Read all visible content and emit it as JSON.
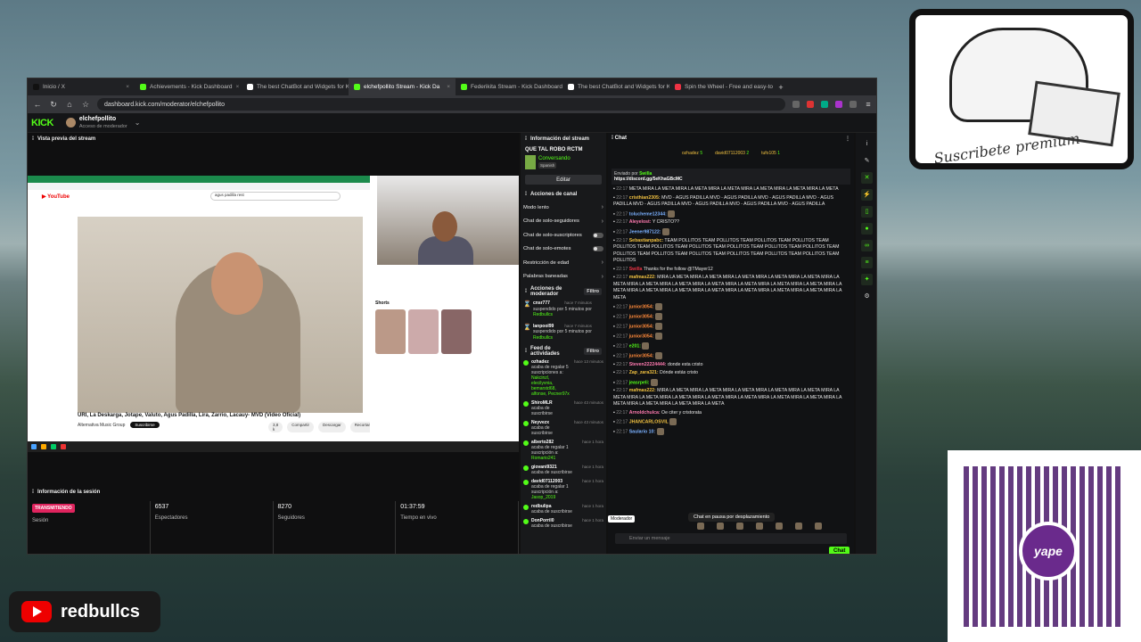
{
  "overlay": {
    "cat_caption": "Suscribete premium",
    "qr_brand": "yape",
    "channel_badge": "redbullcs"
  },
  "browser": {
    "tabs": [
      {
        "label": "Inicio / X",
        "color": "#111111",
        "active": false
      },
      {
        "label": "Achievements - Kick Dashboard",
        "color": "#53fc18",
        "active": false
      },
      {
        "label": "The best ChatBot and Widgets for K",
        "color": "#ffffff",
        "active": false
      },
      {
        "label": "elchefpollito Stream - Kick Da",
        "color": "#53fc18",
        "active": true
      },
      {
        "label": "Federikita Stream - Kick Dashboard",
        "color": "#53fc18",
        "active": false
      },
      {
        "label": "The best ChatBot and Widgets for K",
        "color": "#ffffff",
        "active": false
      },
      {
        "label": "Spin the Wheel - Free and easy-to",
        "color": "#e34",
        "active": false
      }
    ],
    "url": "dashboard.kick.com/moderator/elchefpollito"
  },
  "kick": {
    "logo": "KICK",
    "channel": "elchefpollito",
    "role": "Acceso de moderador"
  },
  "preview": {
    "title": "Vista previa del stream",
    "yt_search": "agus padilla rest",
    "video_title": "URI, La Deskarga, Jotape, Valuto, Agus Padilla, Lira, Zarrio, Lacauy- MVD (Video Oficial)",
    "video_channel": "Alternativa Music Group",
    "subscribe": "Suscribirse",
    "actions": [
      "3,8 k",
      "Compartir",
      "Descargar",
      "Recortar"
    ],
    "shorts_label": "Shorts"
  },
  "session": {
    "title": "Información de la sesión",
    "live_badge": "TRANSMITIENDO",
    "stats": [
      {
        "value": "",
        "label": "Sesión"
      },
      {
        "value": "6537",
        "label": "Espectadores"
      },
      {
        "value": "8270",
        "label": "Seguidores"
      },
      {
        "value": "01:37:59",
        "label": "Tiempo en vivo"
      }
    ]
  },
  "stream_info": {
    "title": "Información del stream",
    "stream_title": "QUE TAL ROBO RCTM",
    "category": "Conversando",
    "language": "Spanish",
    "edit": "Editar"
  },
  "channel_actions": {
    "title": "Acciones de canal",
    "items": [
      {
        "label": "Modo lento",
        "type": "chevron"
      },
      {
        "label": "Chat de solo-seguidores",
        "type": "chevron"
      },
      {
        "label": "Chat de solo-suscriptores",
        "type": "toggle"
      },
      {
        "label": "Chat de solo-emotes",
        "type": "toggle"
      },
      {
        "label": "Restricción de edad",
        "type": "chevron"
      },
      {
        "label": "Palabras baneadas",
        "type": "chevron"
      }
    ]
  },
  "mod_actions": {
    "title": "Acciones de moderador",
    "filter": "Filtro",
    "items": [
      {
        "user": "cnsr777",
        "text": "suspendido por 5 minutos por",
        "by": "Redbullcs",
        "time": "hace 7 minutos"
      },
      {
        "user": "lanpool99",
        "text": "suspendido por 5 minutos por",
        "by": "Redbullcs",
        "time": "hace 7 minutos"
      }
    ]
  },
  "activity": {
    "title": "Feed de actividades",
    "filter": "Filtro",
    "items": [
      {
        "user": "ozhadez",
        "text": "acaba de regalar 5 suscripciones a:",
        "extra": "Nakcinzl, elecilyvnia, bemarstd68, alfonse, Pecner97x",
        "time": "hace 13 minutos"
      },
      {
        "user": "ShiroMLR",
        "text": "acaba de suscribirse",
        "extra": "",
        "time": "hace 43 minutos"
      },
      {
        "user": "Neyvezx",
        "text": "acaba de suscribirse",
        "extra": "",
        "time": "hace 43 minutos"
      },
      {
        "user": "alberto282",
        "text": "acaba de regalar 1 suscripción a:",
        "extra": "Romario241",
        "time": "hace 1 hora"
      },
      {
        "user": "giovani9321",
        "text": "acaba de suscribirse",
        "extra": "",
        "time": "hace 1 hora"
      },
      {
        "user": "david07112003",
        "text": "acaba de regalar 1 suscripción a:",
        "extra": "Jasop_2019",
        "time": "hace 1 hora"
      },
      {
        "user": "redbulipa",
        "text": "acaba de suscribirse",
        "extra": "",
        "time": "hace 1 hora"
      },
      {
        "user": "DonPorril0",
        "text": "acaba de suscribirse",
        "extra": "",
        "time": "hace 1 hora"
      }
    ]
  },
  "chat": {
    "title": "Chat",
    "leaders": [
      {
        "name": "ozhadez",
        "count": "5"
      },
      {
        "name": "david07112003",
        "count": "2"
      },
      {
        "name": "tufo105",
        "count": "1"
      }
    ],
    "pinned_by": "Enviado por",
    "pinned_user": "Swilla",
    "pinned_link": "https://discord.gg/5eKhaGBcMC",
    "messages": [
      {
        "time": "22:17",
        "user": "",
        "color": "#dddddd",
        "text": "META MIRA LA META MIRA LA META MIRA LA META MIRA LA META MIRA LA META MIRA LA META"
      },
      {
        "time": "22:17",
        "user": "cristhian2305:",
        "color": "#f0c040",
        "text": "MVD - AGUS PADILLA MVD - AGUS PADILLA MVD - AGUS PADILLA MVD - AGUS PADILLA MVD - AGUS PADILLA MVD - AGUS PADILLA MVD - AGUS PADILLA MVD - AGUS PADILLA"
      },
      {
        "time": "22:17",
        "user": "tolucheme12344:",
        "color": "#7ab0ff",
        "text": ""
      },
      {
        "time": "22:17",
        "user": "Aleyelost:",
        "color": "#ff7ab0",
        "text": "Y CRISTO??"
      },
      {
        "time": "22:17",
        "user": "Jeener987122:",
        "color": "#7ab0ff",
        "text": ""
      },
      {
        "time": "22:17",
        "user": "Sebastianpabc:",
        "color": "#f0c040",
        "text": "TEAM POLLITOS TEAM POLLITOS TEAM POLLITOS TEAM POLLITOS TEAM POLLITOS TEAM POLLITOS TEAM POLLITOS TEAM POLLITOS TEAM POLLITOS TEAM POLLITOS TEAM POLLITOS TEAM POLLITOS TEAM POLLITOS TEAM POLLITOS TEAM POLLITOS TEAM POLLITOS TEAM POLLITOS"
      },
      {
        "time": "22:17",
        "user": "Swilla",
        "color": "#e34",
        "text": "Thanks for the follow @TMayer12"
      },
      {
        "time": "22:17",
        "user": "mafmas222:",
        "color": "#f0c040",
        "text": "MIRA LA META MIRA LA META MIRA LA META MIRA LA META MIRA LA META MIRA LA META MIRA LA META MIRA LA META MIRA LA META MIRA LA META MIRA LA META MIRA LA META MIRA LA META MIRA LA META MIRA LA META MIRA LA META MIRA LA META MIRA LA META MIRA LA META MIRA LA META"
      },
      {
        "time": "22:17",
        "user": "junior3054:",
        "color": "#ff8a3a",
        "text": ""
      },
      {
        "time": "22:17",
        "user": "junior3054:",
        "color": "#ff8a3a",
        "text": ""
      },
      {
        "time": "22:17",
        "user": "junior3054:",
        "color": "#ff8a3a",
        "text": ""
      },
      {
        "time": "22:17",
        "user": "junior3054:",
        "color": "#ff8a3a",
        "text": ""
      },
      {
        "time": "22:17",
        "user": "e201:",
        "color": "#53fc18",
        "text": ""
      },
      {
        "time": "22:17",
        "user": "junior3054:",
        "color": "#ff8a3a",
        "text": ""
      },
      {
        "time": "22:17",
        "user": "Steven22224444:",
        "color": "#ff7ab0",
        "text": "donde esta cristo"
      },
      {
        "time": "22:17",
        "user": "Zap_zara321:",
        "color": "#f0c040",
        "text": "Dónde estás cristo"
      },
      {
        "time": "22:17",
        "user": "jeasrpeli:",
        "color": "#53fc18",
        "text": ""
      },
      {
        "time": "22:17",
        "user": "mafmas222:",
        "color": "#f0c040",
        "text": "MIRA LA META MIRA LA META MIRA LA META MIRA LA META MIRA LA META MIRA LA META MIRA LA META MIRA LA META MIRA LA META MIRA LA META MIRA LA META MIRA LA META MIRA LA META MIRA LA META MIRA LA META MIRA LA META"
      },
      {
        "time": "22:17",
        "user": "Arnoldchulca:",
        "color": "#ff7ab0",
        "text": "Oe citer y cristorata"
      },
      {
        "time": "22:17",
        "user": "JHANCARLOSVIL",
        "color": "#f0c040",
        "text": ""
      },
      {
        "time": "22:17",
        "user": "Saulario 10:",
        "color": "#7ab0ff",
        "text": ""
      }
    ],
    "paused": "Chat en pausa por desplazamiento",
    "role_tag": "Moderador",
    "input_placeholder": "Enviar un mensaje",
    "send": "Chat"
  },
  "colors": {
    "kick_green": "#53fc18",
    "panel_bg": "#18191b",
    "live_red": "#e0245e"
  }
}
